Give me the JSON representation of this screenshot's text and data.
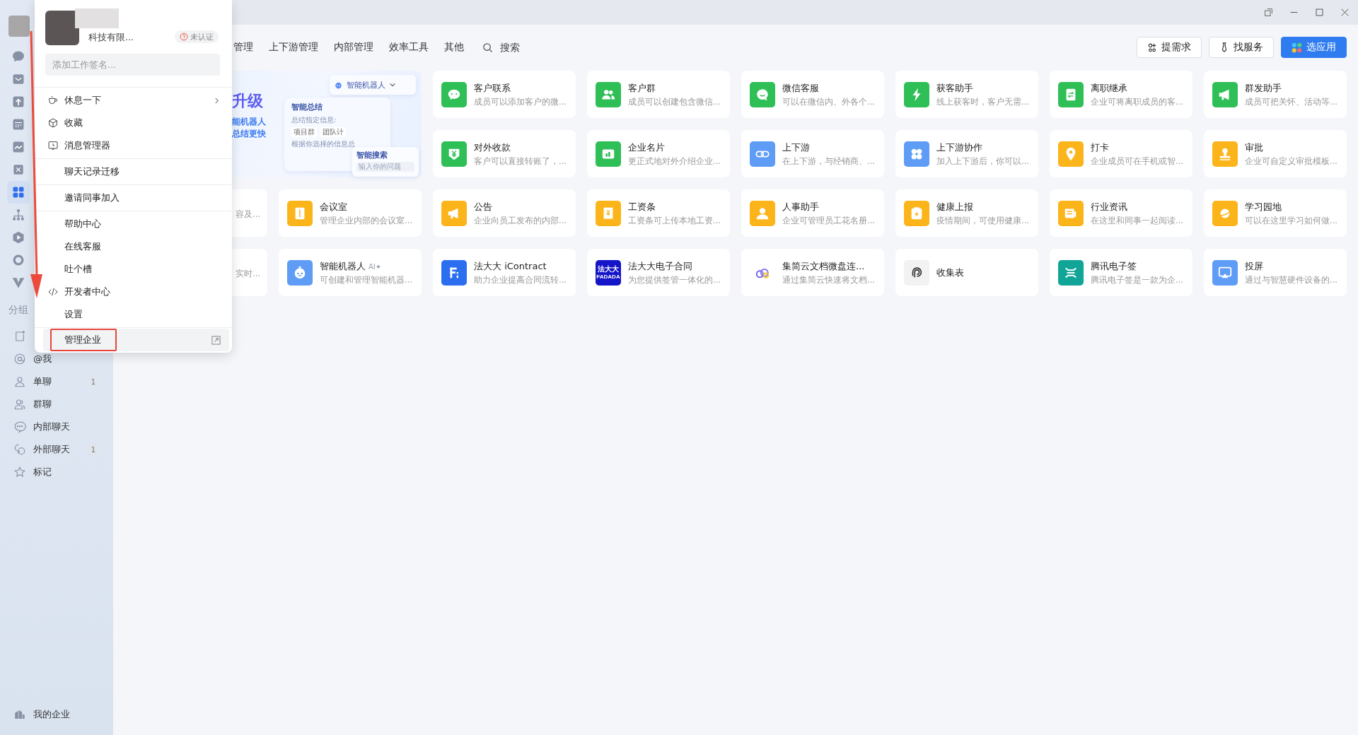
{
  "sidebar": {
    "rail": [
      {
        "kind": "chat",
        "selected": false
      },
      {
        "kind": "mail",
        "selected": false
      },
      {
        "kind": "upload",
        "selected": false
      },
      {
        "kind": "calendar",
        "selected": false
      },
      {
        "kind": "chart",
        "selected": false
      },
      {
        "kind": "tools",
        "selected": false
      },
      {
        "kind": "grid",
        "selected": true
      },
      {
        "kind": "tree",
        "selected": false
      },
      {
        "kind": "play",
        "selected": false
      },
      {
        "kind": "ring",
        "selected": false
      },
      {
        "kind": "vee",
        "selected": false
      }
    ],
    "group_label": "分组",
    "groups": [
      {
        "kind": "note"
      },
      {
        "kind": "at",
        "label": "@我"
      },
      {
        "kind": "person",
        "label": "单聊",
        "badge": "1"
      },
      {
        "kind": "people",
        "label": "群聊"
      },
      {
        "kind": "dots",
        "label": "内部聊天"
      },
      {
        "kind": "double",
        "label": "外部聊天",
        "badge": "1"
      },
      {
        "kind": "star",
        "label": "标记"
      }
    ],
    "footer": "我的企业"
  },
  "tabs": [
    {
      "label": "管理",
      "selected": false
    },
    {
      "label": "上下游管理",
      "selected": false
    },
    {
      "label": "内部管理",
      "selected": false
    },
    {
      "label": "效率工具",
      "selected": false
    },
    {
      "label": "其他",
      "selected": false
    }
  ],
  "search": {
    "placeholder": "搜索"
  },
  "actions": [
    {
      "label": "提需求",
      "kind": "idea",
      "primary": false
    },
    {
      "label": "找服务",
      "kind": "tie",
      "primary": false
    },
    {
      "label": "选应用",
      "kind": "apps",
      "primary": true
    }
  ],
  "banner": {
    "headline": "升级",
    "lines": [
      "能机器人",
      "总结更快"
    ],
    "robot_panel": "智能机器人",
    "summary_panel": {
      "title": "智能总结",
      "hint": "总结指定信息:",
      "chips": [
        "项目群",
        "团队计"
      ],
      "note": "根据你选择的信息总"
    },
    "search_panel": {
      "title": "智能搜索",
      "placeholder": "输入你的问题"
    }
  },
  "apps": [
    {
      "kind": "hidden"
    },
    {
      "kind": "hidden"
    },
    {
      "kind": "chat",
      "color": "#2fbf57",
      "title": "客户联系",
      "desc": "成员可以添加客户的微..."
    },
    {
      "kind": "people",
      "color": "#2fbf57",
      "title": "客户群",
      "desc": "成员可以创建包含微信..."
    },
    {
      "kind": "bubble",
      "color": "#2fbf57",
      "title": "微信客服",
      "desc": "可以在微信内、外各个..."
    },
    {
      "kind": "bolt",
      "color": "#2fbf57",
      "title": "获客助手",
      "desc": "线上获客时，客户无需..."
    },
    {
      "kind": "swap",
      "color": "#2fbf57",
      "title": "离职继承",
      "desc": "企业可将离职成员的客..."
    },
    {
      "kind": "megaphone",
      "color": "#2fbf57",
      "title": "群发助手",
      "desc": "成员可把关怀、活动等..."
    },
    {
      "kind": "hidden"
    },
    {
      "kind": "hidden"
    },
    {
      "kind": "yen",
      "color": "#2fbf57",
      "title": "对外收款",
      "desc": "客户可以直接转账了，..."
    },
    {
      "kind": "card",
      "color": "#2fbf57",
      "title": "企业名片",
      "desc": "更正式地对外介绍企业..."
    },
    {
      "kind": "link",
      "color": "#5e9cf5",
      "title": "上下游",
      "desc": "在上下游，与经销商、..."
    },
    {
      "kind": "clover",
      "color": "#5e9cf5",
      "title": "上下游协作",
      "desc": "加入上下游后，你可以..."
    },
    {
      "kind": "pin",
      "color": "#fbb51b",
      "title": "打卡",
      "desc": "企业成员可在手机或智..."
    },
    {
      "kind": "stamp",
      "color": "#fbb51b",
      "title": "审批",
      "desc": "企业可自定义审批模板..."
    },
    {
      "kind": "partial",
      "desc": "容及..."
    },
    {
      "kind": "door",
      "color": "#fbb51b",
      "title": "会议室",
      "desc": "管理企业内部的会议室..."
    },
    {
      "kind": "megaphone",
      "color": "#fbb51b",
      "title": "公告",
      "desc": "企业向员工发布的内部..."
    },
    {
      "kind": "receipt",
      "color": "#fbb51b",
      "title": "工资条",
      "desc": "工资条可上传本地工资..."
    },
    {
      "kind": "person",
      "color": "#fbb51b",
      "title": "人事助手",
      "desc": "企业可管理员工花名册..."
    },
    {
      "kind": "clipboard",
      "color": "#fbb51b",
      "title": "健康上报",
      "desc": "疫情期间，可使用健康..."
    },
    {
      "kind": "news",
      "color": "#fbb51b",
      "title": "行业资讯",
      "desc": "在这里和同事一起阅读..."
    },
    {
      "kind": "planet",
      "color": "#fbb51b",
      "title": "学习园地",
      "desc": "可以在这里学习如何做..."
    },
    {
      "kind": "partial",
      "desc": "实时..."
    },
    {
      "kind": "robot",
      "color": "#5e9cf5",
      "title": "智能机器人",
      "tag": "AI✦",
      "desc": "可创建和管理智能机器..."
    },
    {
      "kind": "letter",
      "color": "#2b6ff0",
      "title": "法大大 iContract",
      "desc": "助力企业提高合同流转..."
    },
    {
      "kind": "logo",
      "color": "#1414c8",
      "title": "法大大电子合同",
      "logo_text": [
        "法大大",
        "FADADA"
      ],
      "desc": "为您提供签管一体化的..."
    },
    {
      "kind": "cloud",
      "color": "#ffffff",
      "title": "集简云文档微盘连...",
      "desc": "通过集简云快速将文档..."
    },
    {
      "kind": "form",
      "color": "#f2f2f2",
      "title": "收集表"
    },
    {
      "kind": "sign",
      "color": "#10a596",
      "title": "腾讯电子签",
      "desc": "腾讯电子签是一款为企..."
    },
    {
      "kind": "cast",
      "color": "#5e9cf5",
      "title": "投屏",
      "desc": "通过与智慧硬件设备的..."
    }
  ],
  "account_menu": {
    "company": "科技有限...",
    "badge": "未认证",
    "signature_placeholder": "添加工作签名...",
    "sections": [
      [
        {
          "label": "休息一下",
          "kind": "cup",
          "submenu": true
        },
        {
          "label": "收藏",
          "kind": "cube"
        },
        {
          "label": "消息管理器",
          "kind": "monitor"
        }
      ],
      [
        {
          "label": "聊天记录迁移"
        }
      ],
      [
        {
          "label": "邀请同事加入"
        }
      ],
      [
        {
          "label": "帮助中心"
        },
        {
          "label": "在线客服"
        },
        {
          "label": "吐个槽"
        },
        {
          "label": "开发者中心",
          "kind": "code"
        },
        {
          "label": "设置"
        }
      ],
      [
        {
          "label": "管理企业",
          "external": true,
          "highlighted": true
        }
      ]
    ]
  }
}
